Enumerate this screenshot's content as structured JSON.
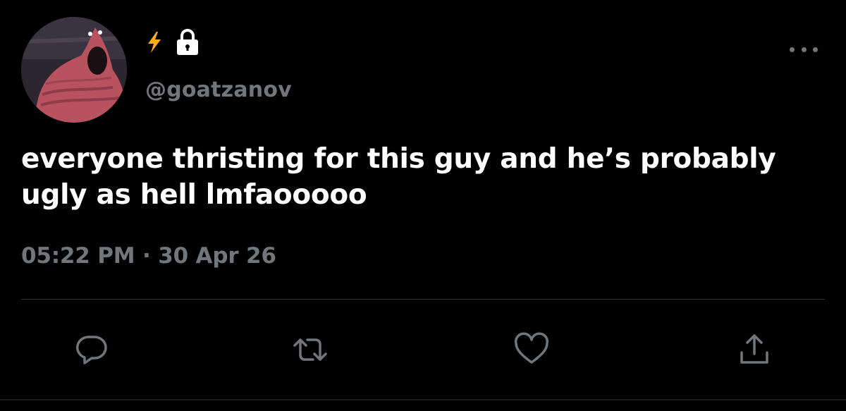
{
  "header": {
    "handle": "@goatzanov"
  },
  "tweet": {
    "text": "everyone thristing for this guy and he’s probably ugly as hell lmfaooooo",
    "time": "05:22 PM",
    "separator": "·",
    "date": "30 Apr 26"
  },
  "icons": {
    "badge": "lightning-icon",
    "protected": "lock-icon",
    "more": "more-icon",
    "reply": "reply-icon",
    "retweet": "retweet-icon",
    "like": "heart-icon",
    "share": "share-icon"
  },
  "colors": {
    "background": "#000000",
    "text_primary": "#ffffff",
    "text_secondary": "#71767b",
    "icon": "#71767b",
    "badge": "#ffad1f",
    "divider": "#2f3336"
  }
}
